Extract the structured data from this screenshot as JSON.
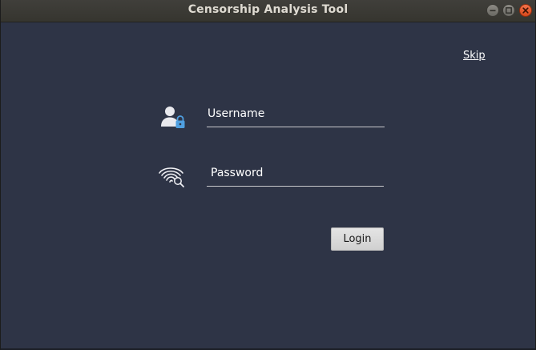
{
  "window": {
    "title": "Censorship Analysis Tool"
  },
  "header": {
    "skip_label": "Skip"
  },
  "form": {
    "username_value": "Username",
    "password_value": "Password",
    "login_label": "Login"
  },
  "icons": {
    "username": "user-lock-icon",
    "password": "fingerprint-icon"
  },
  "colors": {
    "background": "#2e3446",
    "titlebar": "#3b3a36",
    "close_button": "#e5562a",
    "lock_accent": "#4f9fe0",
    "button_bg": "#dcdcdc"
  }
}
